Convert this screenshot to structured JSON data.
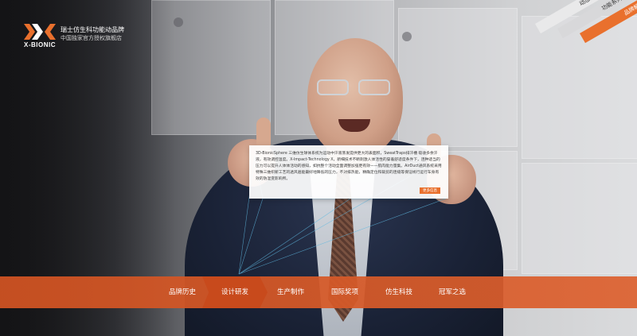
{
  "logo": {
    "wordmark": "X-BIONIC",
    "line1": "瑞士仿生科功能动品牌",
    "line2": "中国独家官方授权旗舰店"
  },
  "ribbons": [
    "动态首页",
    "功能系列",
    "品牌解读"
  ],
  "card": {
    "text": "3D-BionicSphere 三维仿生球体系统为运动中汗液蒸发提供更大的表面积，SweatTraps排汗槽 吸收多余汗液，有效调控温度。X-Impact-Technology X，新细技术不断刺激人体活性的穿着舒适度条件下，连种适当的压力可以提升人体体活动的感知，如抗整个活动全面调整加强更有效——肌肉能力量集。AirDuct通风系统采用特殊三维织新工艺的透风遍能最好地降低的压力，不对排热能，精确定位和裁剪的连缝等保证线行运行车身有效的防湿变影响所。",
    "button": "更多信息"
  },
  "nav": {
    "items": [
      "品牌历史",
      "设计研发",
      "生产制作",
      "国际奖项",
      "仿生科技",
      "冠军之选"
    ],
    "active_index": 1
  },
  "colors": {
    "accent": "#e9702d",
    "nav_bar": "#d4582a",
    "nav_active": "#c84a1c"
  }
}
